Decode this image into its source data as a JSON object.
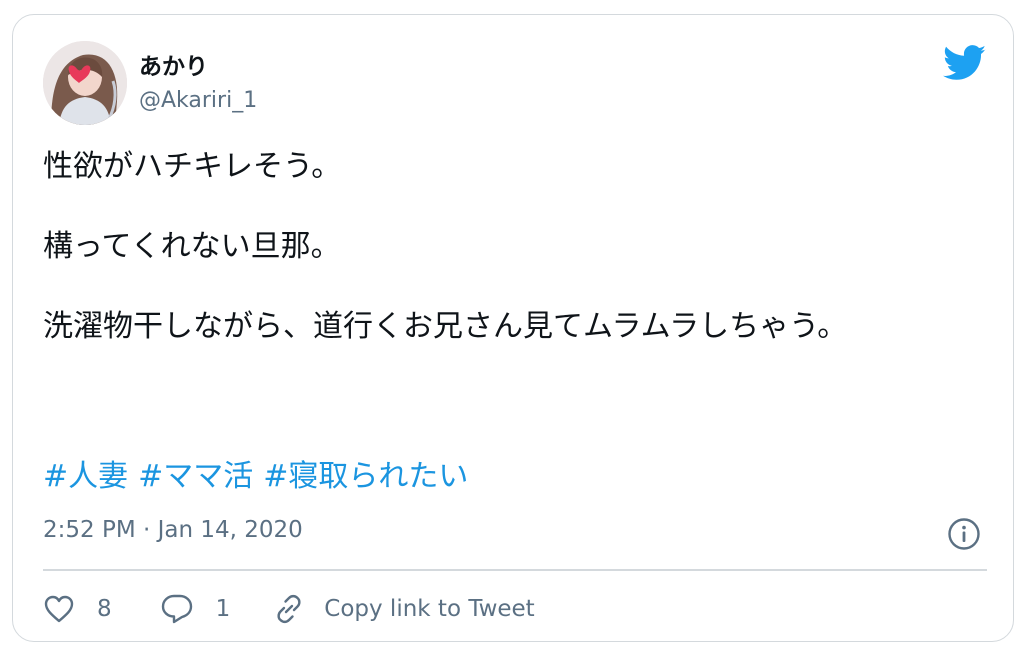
{
  "user": {
    "display_name": "あかり",
    "handle": "@Akariri_1"
  },
  "tweet": {
    "paragraphs": [
      "性欲がハチキレそう。",
      "構ってくれない旦那。",
      "洗濯物干しながら、道行くお兄さん見てムラムラしちゃう。"
    ],
    "hashtags": [
      "#人妻",
      "#ママ活",
      "#寝取られたい"
    ],
    "timestamp": "2:52 PM · Jan 14, 2020"
  },
  "actions": {
    "likes": "8",
    "replies": "1",
    "copy_link_label": "Copy link to Tweet"
  },
  "icons": {
    "brand": "twitter-bird-icon",
    "info": "info-icon",
    "like": "heart-icon",
    "reply": "reply-bubble-icon",
    "link": "link-icon"
  },
  "colors": {
    "brand_blue": "#1da1f2",
    "hashtag_blue": "#1b95e0",
    "secondary_text": "#5b7083",
    "border": "#d4d9dd"
  }
}
